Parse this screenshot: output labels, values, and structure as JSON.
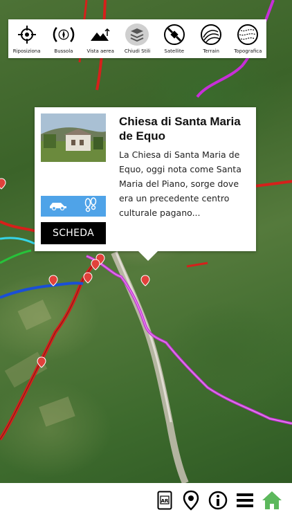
{
  "toolbar": {
    "items": [
      {
        "label": "Riposiziona",
        "icon": "crosshair-icon"
      },
      {
        "label": "Bussola",
        "icon": "compass-icon"
      },
      {
        "label": "Vista aerea",
        "icon": "mountain-icon"
      },
      {
        "label": "Chiudi Stili",
        "icon": "layers-icon"
      },
      {
        "label": "Satellite",
        "icon": "satellite-icon"
      },
      {
        "label": "Terrain",
        "icon": "terrain-icon"
      },
      {
        "label": "Topografica",
        "icon": "topographic-icon"
      }
    ],
    "active_index": 3
  },
  "popup": {
    "title": "Chiesa di Santa Maria de Equo",
    "description": "La Chiesa di Santa Maria de Equo, oggi nota come Santa Maria del Piano, sorge dove era un precedente centro culturale pagano...",
    "button_label": "SCHEDA",
    "modes": [
      "car-icon",
      "footprints-icon"
    ],
    "mode_color": "#4fa3e8"
  },
  "bottom_bar": {
    "items": [
      "ar-icon",
      "location-pin-icon",
      "info-icon",
      "menu-icon",
      "home-icon"
    ],
    "home_color": "#5cb85c"
  },
  "map": {
    "route_colors": {
      "magenta": "#c72fd8",
      "red": "#d6201b",
      "blue": "#1a4fd6",
      "cyan": "#35d5e8",
      "green": "#27c23a"
    }
  }
}
